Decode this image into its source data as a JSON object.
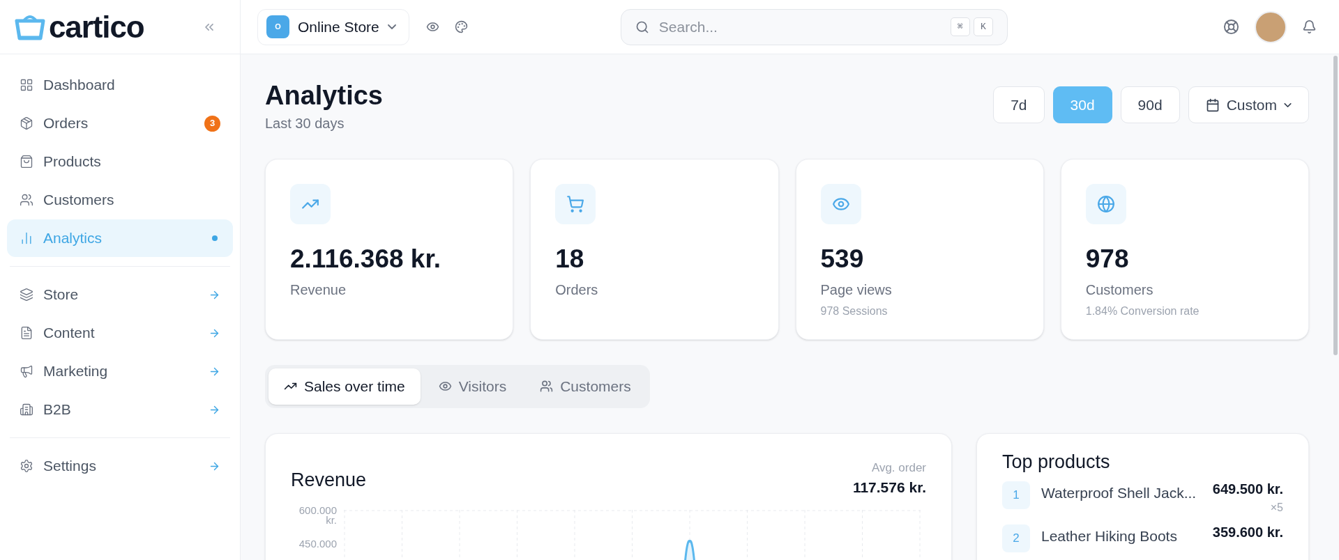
{
  "brand": {
    "name": "cartico"
  },
  "sidebar": {
    "groups": [
      {
        "items": [
          {
            "label": "Dashboard",
            "kind": "page",
            "selected": false
          },
          {
            "label": "Orders",
            "kind": "page",
            "selected": false,
            "badge": "3"
          },
          {
            "label": "Products",
            "kind": "page",
            "selected": false
          },
          {
            "label": "Customers",
            "kind": "page",
            "selected": false
          },
          {
            "label": "Analytics",
            "kind": "page",
            "selected": true
          }
        ]
      },
      {
        "items": [
          {
            "label": "Store",
            "kind": "section",
            "selected": false
          },
          {
            "label": "Content",
            "kind": "section",
            "selected": false
          },
          {
            "label": "Marketing",
            "kind": "section",
            "selected": false
          },
          {
            "label": "B2B",
            "kind": "section",
            "selected": false
          }
        ]
      },
      {
        "items": [
          {
            "label": "Settings",
            "kind": "section",
            "selected": false
          }
        ]
      }
    ]
  },
  "topbar": {
    "store": {
      "initial": "O",
      "name": "Online Store"
    },
    "search": {
      "placeholder": "Search...",
      "shortcut": [
        "⌘",
        "K"
      ]
    }
  },
  "page": {
    "title": "Analytics",
    "subtitle": "Last 30 days"
  },
  "ranges": [
    {
      "label": "7d",
      "kind": "preset",
      "selected": false
    },
    {
      "label": "30d",
      "kind": "preset",
      "selected": true
    },
    {
      "label": "90d",
      "kind": "preset",
      "selected": false
    },
    {
      "label": "Custom",
      "kind": "dropdown",
      "selected": false
    }
  ],
  "stats": [
    {
      "value": "2.116.368 kr.",
      "label": "Revenue"
    },
    {
      "value": "18",
      "label": "Orders"
    },
    {
      "value": "539",
      "label": "Page views",
      "note": "978 Sessions"
    },
    {
      "value": "978",
      "label": "Customers",
      "note": "1.84% Conversion rate"
    }
  ],
  "tabs": [
    {
      "label": "Sales over time",
      "selected": true
    },
    {
      "label": "Visitors",
      "selected": false
    },
    {
      "label": "Customers",
      "selected": false
    }
  ],
  "revenue": {
    "title": "Revenue",
    "avg_label": "Avg. order",
    "avg_value": "117.576 kr.",
    "y_labels": [
      "600.000 kr.",
      "450.000"
    ]
  },
  "top_products": {
    "title": "Top products",
    "items": [
      {
        "rank": "1",
        "name": "Waterproof Shell Jack...",
        "amount": "649.500 kr.",
        "qty": "×5"
      },
      {
        "rank": "2",
        "name": "Leather Hiking Boots",
        "amount": "359.600 kr."
      }
    ]
  }
}
